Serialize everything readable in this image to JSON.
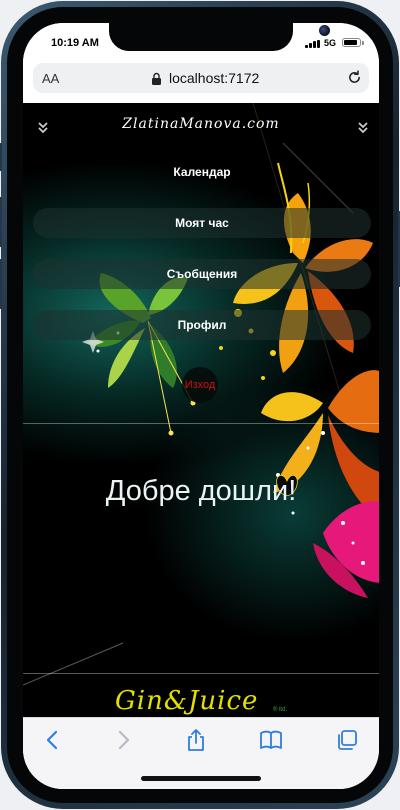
{
  "status_bar": {
    "time": "10:19 AM",
    "network": "5G",
    "signal_bars": 4,
    "battery_level": 0.85
  },
  "browser": {
    "text_size_label": "AA",
    "url": "localhost:7172"
  },
  "site": {
    "logo": "ZlatinaManova.com",
    "nav": [
      {
        "label": "Календар"
      },
      {
        "label": "Моят час"
      },
      {
        "label": "Съобщения"
      },
      {
        "label": "Профил"
      }
    ],
    "logout_label": "Изход",
    "welcome": "Добре дошли!",
    "footer_logo": "Gin&Juice",
    "footer_mark": "® ltd."
  },
  "colors": {
    "logout": "#c81414",
    "footer_logo": "#e3e000",
    "toolbar_icon": "#2f7de1"
  },
  "icons": [
    "chevron-double-down-icon",
    "lock-icon",
    "reload-icon",
    "back-icon",
    "forward-icon",
    "share-icon",
    "bookmarks-icon",
    "tabs-icon"
  ]
}
